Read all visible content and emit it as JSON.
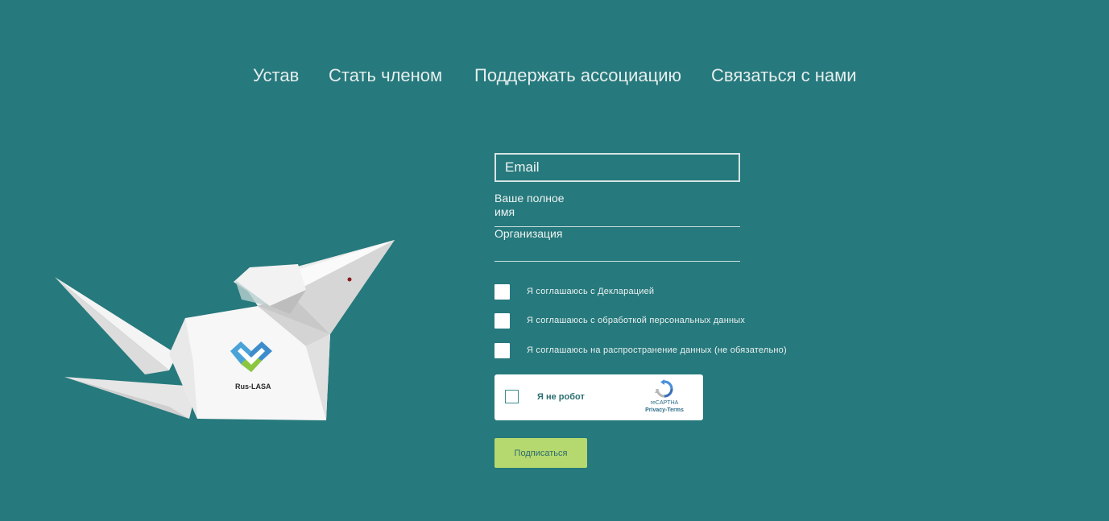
{
  "nav": {
    "items": [
      {
        "label": "Устав"
      },
      {
        "label": "Стать членом"
      },
      {
        "label": "Поддержать ассоциацию"
      },
      {
        "label": "Связаться с нами"
      }
    ]
  },
  "illustration": {
    "brand_text": "Rus-LASA",
    "icon": "origami-mouse-image"
  },
  "form": {
    "email_placeholder": "Email",
    "full_name_label": "Ваше полное имя",
    "organization_label": "Организация",
    "consents": [
      {
        "label": "Я соглашаюсь с Декларацией",
        "checked": false
      },
      {
        "label": "Я соглашаюсь с обработкой персональных данных",
        "checked": false
      },
      {
        "label": "Я соглашаюсь на распространение данных (не обязательно)",
        "checked": false
      }
    ],
    "captcha": {
      "label": "Я не робот",
      "brand": "reCAPTHA",
      "links": "Privacy-Terms",
      "icon": "recaptcha-icon"
    },
    "submit_label": "Подписаться"
  },
  "colors": {
    "background": "#26797c",
    "submit": "#b6d96f"
  }
}
